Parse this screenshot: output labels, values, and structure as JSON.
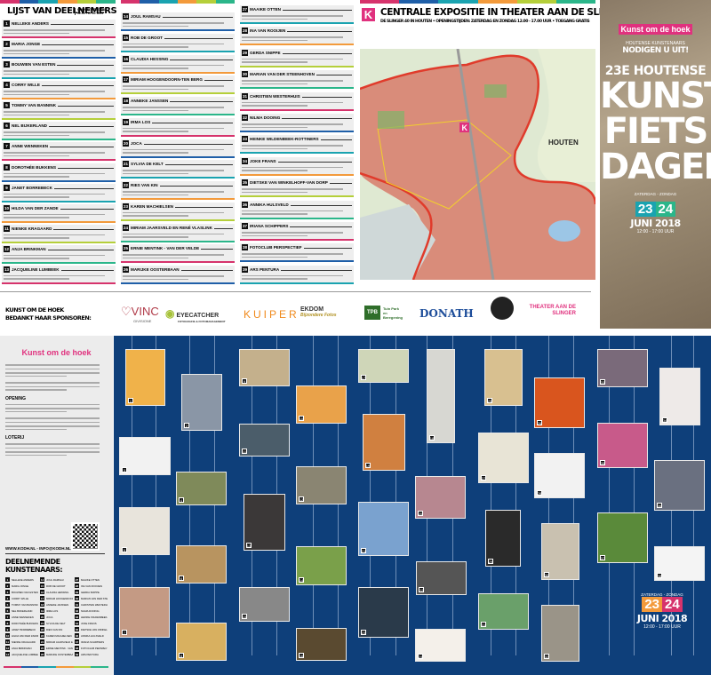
{
  "list": {
    "title": "LIJST VAN DEELNEMERS",
    "note": "OPENINGSTIJDEN: 12.00 - 17.00 UUR",
    "colors": [
      "#d6336c",
      "#1f5fa8",
      "#1aa3b0",
      "#f39a3b",
      "#b5cf3a",
      "#2bb68a"
    ],
    "participants": [
      "NELLEKE ANDERS",
      "MARIA JONGE",
      "BOUWIEN VAN ESTEN",
      "CORRY WILLE",
      "TOMMY VAN BANNINK",
      "NEL BIJKERLAND",
      "ANNE WENNEKEN",
      "DOROTHÉE BUKKENS",
      "JANET BORREBECK",
      "HILDA VAN DER ZANDE",
      "NIENKE KRAGAARD",
      "ANJA BRINKMAN",
      "JACQUELINE LUMBEEK",
      "JOUL RAMSAU",
      "ROB DE GROOT",
      "CLAUDIA HESSING",
      "MIRIAM HOOGENDOORN-TEN BERG",
      "ANNEKE JANSSEN",
      "IRMA LOS",
      "JOCA",
      "SYLVIA DE KELT",
      "RIES VAN KIN",
      "KAREN MACHIELSEN",
      "MIRIAM JAARSVELD EN RENÉ VLASLINK",
      "ERNIE MENTINK - VAN DER VELDE",
      "MARIJKE OOSTERBAAN",
      "MAAIKE OTTEN",
      "INA VAN ROOIJEN",
      "GERDA SNIPPE",
      "MARIAN VAN DER STEENHOVEN",
      "CHRISTIEN WESTERHUIS",
      "NILMA DOOING",
      "HEINKE WILDENBEEK-ROTTINERS",
      "JOKE FRANS",
      "DIETSKE VAN WINKELHOFF-VAN DORP",
      "ANNIKA HULSVELD",
      "IRIANA SCHIPPERS",
      "FOTOCLUB PERSPECTIEF",
      "ARS PENTURA"
    ]
  },
  "sponsors": {
    "thanks_line1": "KUNST OM DE HOEK",
    "thanks_line2": "BEDANKT HAAR SPONSOREN:",
    "names": [
      "VINC",
      "EYECATCHER",
      "KUIPER",
      "EKDOM",
      "TPB",
      "DONATH",
      "THEATER AAN DE SLINGER"
    ],
    "vinc_sub": "GIVISIONE",
    "eyecatcher_sub": "FOTOGRAFIE & FOTOMANAGEMENT",
    "ekdom_sub": "Bijzondere Fotos",
    "tpb_sub": "Tuin Park en Beregening"
  },
  "expo": {
    "title": "CENTRALE EXPOSITIE IN THEATER AAN DE SLINGER",
    "subtitle": "DE SLINGER 40 IN HOUTEN • OPENINGSTIJDEN: ZATERDAG EN ZONDAG 12.00 - 17.00 UUR • TOEGANG GRATIS",
    "map_label": "HOUTEN",
    "logo_letter": "K"
  },
  "cover": {
    "brand": "Kunst om de hoek",
    "tagline1": "HOUTENSE KUNSTENAARS",
    "tagline2": "NODIGEN U UIT!",
    "edition": "23E HOUTENSE",
    "word1": "KUNST",
    "word2": "FIETS",
    "word3": "DAGEN",
    "days": "ZATERDAG - ZONDAG",
    "day1": "23",
    "day2": "24",
    "month": "JUNI 2018",
    "hours": "12:00 - 17:00 UUR"
  },
  "info": {
    "brand": "Kunst om de hoek",
    "opening_heading": "OPENING",
    "lottery_heading": "LOTERIJ",
    "contact": "WWW.KODH.NL - INFO@KODH.NL",
    "artists_heading": "DEELNEMENDE KUNSTENAARS:"
  },
  "gallery": {
    "artworks": [
      "1",
      "2",
      "3",
      "4",
      "5",
      "6",
      "7",
      "8",
      "9",
      "10",
      "11",
      "12",
      "13",
      "14",
      "15",
      "16",
      "17",
      "18",
      "19",
      "20",
      "21",
      "22",
      "23",
      "24",
      "25",
      "26",
      "27",
      "28",
      "29",
      "30",
      "31",
      "32",
      "33",
      "34",
      "35",
      "36",
      "37",
      "38"
    ],
    "date": {
      "days": "ZATERDAG - ZONDAG",
      "day1": "23",
      "day2": "24",
      "month": "JUNI 2018",
      "hours": "12:00 - 17:00 UUR"
    }
  }
}
